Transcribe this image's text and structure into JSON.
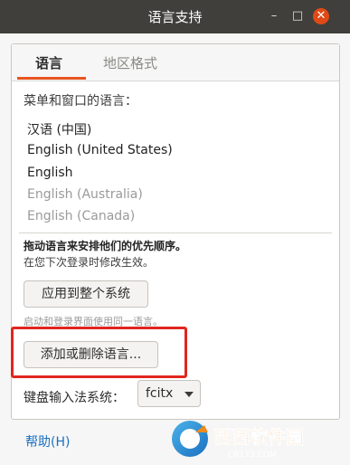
{
  "window": {
    "title": "语言支持"
  },
  "tabs": [
    {
      "label": "语言"
    },
    {
      "label": "地区格式"
    }
  ],
  "language": {
    "section_label": "菜单和窗口的语言：",
    "items": [
      {
        "label": "汉语 (中国)"
      },
      {
        "label": "English (United States)"
      },
      {
        "label": "English"
      },
      {
        "label": "English (Australia)"
      },
      {
        "label": "English (Canada)"
      }
    ],
    "drag_note": "拖动语言来安排他们的优先顺序。",
    "login_note": "在您下次登录时修改生效。",
    "apply_button": "应用到整个系统",
    "login_screen_note": "启动和登录界面使用同一语言。",
    "add_remove_button": "添加或删除语言...",
    "input_method_label": "键盘输入法系统：",
    "input_method_value": "fcitx"
  },
  "footer": {
    "help_link": "帮助(H)"
  },
  "watermark": {
    "brand": "西西软件园",
    "site": "CR173.COM"
  },
  "colors": {
    "titlebar": "#403f3c",
    "accent": "#e95420",
    "close_button": "#df4a16",
    "highlight_box": "#e0261e",
    "link": "#1a70c0"
  },
  "icons": {
    "minimize": "minimize-icon",
    "maximize": "maximize-icon",
    "close": "close-icon",
    "dropdown": "chevron-down-icon"
  }
}
